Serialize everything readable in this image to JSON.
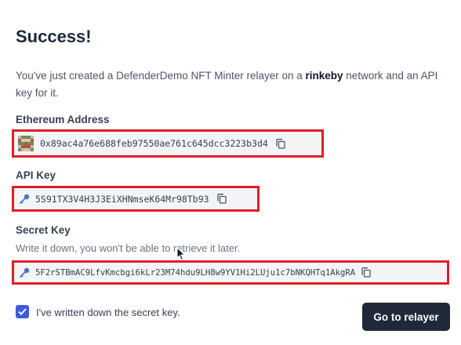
{
  "header": {
    "title": "Success!"
  },
  "description": {
    "part1": "You've just created a DefenderDemo NFT Minter relayer on a ",
    "network": "rinkeby",
    "part2": " network and an API key for it."
  },
  "ethereum": {
    "label": "Ethereum Address",
    "value": "0x89ac4a76e688feb97550ae761c645dcc3223b3d4"
  },
  "api_key": {
    "label": "API Key",
    "value": "5S91TX3V4H3J3EiXHNmseK64Mr98Tb93"
  },
  "secret_key": {
    "label": "Secret Key",
    "hint": "Write it down, you won't be able to retrieve it later.",
    "value": "5F2rSTBmAC9LfvKmcbgi6kLr23M74hdu9LH8w9YV1Hi2LUju1c7bNKQHTq1AkgRA"
  },
  "confirm": {
    "label": "I've written down the secret key.",
    "checked": true
  },
  "actions": {
    "go_label": "Go to relayer"
  },
  "colors": {
    "highlight": "#e11d2a",
    "checkbox": "#3b5bdb",
    "button": "#1f2937",
    "key_icon": "#4f6fd8"
  },
  "icons": [
    "identicon-avatar",
    "key-icon",
    "copy-icon",
    "check-icon",
    "cursor-icon"
  ]
}
